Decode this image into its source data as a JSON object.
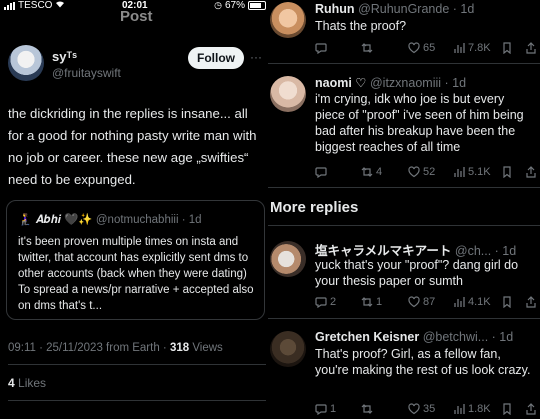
{
  "status_bar": {
    "carrier": "TESCO",
    "time": "02:01",
    "battery": "67%"
  },
  "header": {
    "title": "Post"
  },
  "post": {
    "author_name": "syᵀˢ",
    "author_handle": "@fruitayswift",
    "follow_label": "Follow",
    "more": "···",
    "text": "the dickriding in the replies is insane... all for a good for nothing pasty write man with no job or career. these new age „swifties“ need to be expunged.",
    "quote": {
      "name": "🧎‍♀️ 𝑨𝒃𝒉𝒊 🖤✨",
      "handle": "@notmuchabhiii · 1d",
      "text": "it's been proven multiple times on insta and twitter, that account has explicitly sent dms to other accounts (back when they were dating) To spread a news/pr narrative + accepted also on dms that's t..."
    },
    "meta_time": "09:11 · 25/11/2023 from Earth · ",
    "views_count": "318",
    "views_label": " Views",
    "likes_count": "4",
    "likes_label": " Likes"
  },
  "replies": [
    {
      "name": "Ruhun",
      "handle": "@RuhunGrande · 1d",
      "text": "Thats the proof?",
      "reply_count": "",
      "retweet_count": "",
      "like_count": "65",
      "view_count": "7.8K"
    },
    {
      "name": "naomi ♡",
      "handle": "@itzxnaomiii · 1d",
      "text": "i'm crying, idk who joe is but every piece of \"proof\" i've seen of him being bad after his breakup have been the biggest reaches of all time",
      "reply_count": "",
      "retweet_count": "4",
      "like_count": "52",
      "view_count": "5.1K"
    }
  ],
  "more_replies_label": "More replies",
  "more_replies": [
    {
      "name": "塩キャラメルマキアート",
      "handle": "@ch... · 1d",
      "text": "yuck that's your \"proof\"? dang girl do your thesis paper or sumth",
      "reply_count": "2",
      "retweet_count": "1",
      "like_count": "87",
      "view_count": "4.1K"
    },
    {
      "name": "Gretchen Keisner",
      "handle": "@betchwi... · 1d",
      "text": "That's proof? Girl, as a fellow fan, you're making the rest of us look crazy.",
      "reply_count": "1",
      "retweet_count": "",
      "like_count": "35",
      "view_count": "1.8K"
    }
  ],
  "icons": [
    "reply-icon",
    "retweet-icon",
    "like-icon",
    "views-icon",
    "bookmark-icon",
    "share-icon"
  ],
  "colors": {
    "background": "#000000",
    "text": "#e7e9ea",
    "secondary": "#71767b",
    "divider": "#2f3336",
    "follow_bg": "#eff3f4"
  }
}
